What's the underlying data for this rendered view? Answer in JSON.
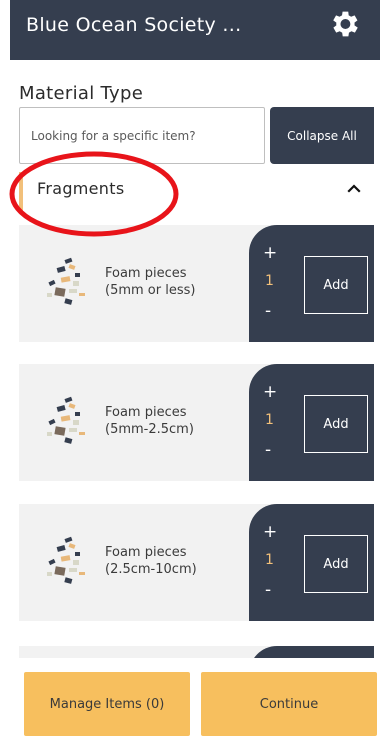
{
  "header": {
    "title": "Blue Ocean Society ...",
    "settings_icon": "gear-icon"
  },
  "material": {
    "section_label": "Material Type",
    "search_placeholder": "Looking for a specific item?",
    "collapse_label": "Collapse All"
  },
  "category": {
    "label": "Fragments",
    "chevron_icon": "chevron-up-icon",
    "accent_color": "#f2c07a"
  },
  "items": [
    {
      "name_line1": "Foam pieces",
      "name_line2": "(5mm or less)",
      "plus": "+",
      "qty": "1",
      "minus": "-",
      "add_label": "Add"
    },
    {
      "name_line1": "Foam pieces",
      "name_line2": "(5mm-2.5cm)",
      "plus": "+",
      "qty": "1",
      "minus": "-",
      "add_label": "Add"
    },
    {
      "name_line1": "Foam pieces",
      "name_line2": "(2.5cm-10cm)",
      "plus": "+",
      "qty": "1",
      "minus": "-",
      "add_label": "Add"
    }
  ],
  "footer": {
    "manage_label": "Manage Items (0)",
    "continue_label": "Continue",
    "button_color": "#f7bf5e"
  },
  "colors": {
    "primary_dark": "#353e4f",
    "highlight_ring": "#e8141a"
  }
}
